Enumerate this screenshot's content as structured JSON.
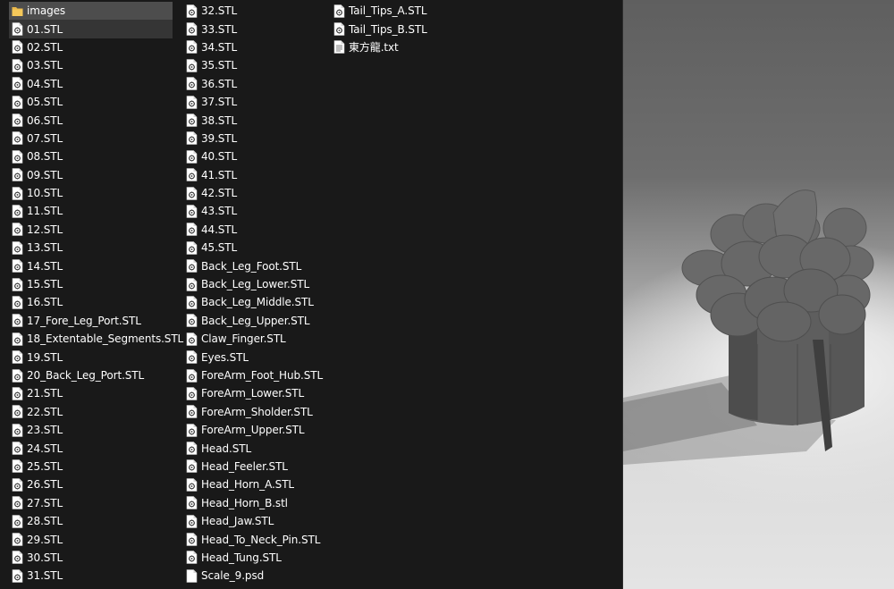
{
  "files": {
    "columns": [
      [
        {
          "name": "images",
          "type": "folder",
          "state": "selected"
        },
        {
          "name": "01.STL",
          "type": "stl",
          "state": "focused"
        },
        {
          "name": "02.STL",
          "type": "stl"
        },
        {
          "name": "03.STL",
          "type": "stl"
        },
        {
          "name": "04.STL",
          "type": "stl"
        },
        {
          "name": "05.STL",
          "type": "stl"
        },
        {
          "name": "06.STL",
          "type": "stl"
        },
        {
          "name": "07.STL",
          "type": "stl"
        },
        {
          "name": "08.STL",
          "type": "stl"
        },
        {
          "name": "09.STL",
          "type": "stl"
        },
        {
          "name": "10.STL",
          "type": "stl"
        },
        {
          "name": "11.STL",
          "type": "stl"
        },
        {
          "name": "12.STL",
          "type": "stl"
        },
        {
          "name": "13.STL",
          "type": "stl"
        },
        {
          "name": "14.STL",
          "type": "stl"
        },
        {
          "name": "15.STL",
          "type": "stl"
        },
        {
          "name": "16.STL",
          "type": "stl"
        },
        {
          "name": "17_Fore_Leg_Port.STL",
          "type": "stl"
        },
        {
          "name": "18_Extentable_Segments.STL",
          "type": "stl"
        },
        {
          "name": "19.STL",
          "type": "stl"
        },
        {
          "name": "20_Back_Leg_Port.STL",
          "type": "stl"
        },
        {
          "name": "21.STL",
          "type": "stl"
        },
        {
          "name": "22.STL",
          "type": "stl"
        },
        {
          "name": "23.STL",
          "type": "stl"
        },
        {
          "name": "24.STL",
          "type": "stl"
        },
        {
          "name": "25.STL",
          "type": "stl"
        },
        {
          "name": "26.STL",
          "type": "stl"
        },
        {
          "name": "27.STL",
          "type": "stl"
        },
        {
          "name": "28.STL",
          "type": "stl"
        },
        {
          "name": "29.STL",
          "type": "stl"
        },
        {
          "name": "30.STL",
          "type": "stl"
        },
        {
          "name": "31.STL",
          "type": "stl"
        }
      ],
      [
        {
          "name": "32.STL",
          "type": "stl"
        },
        {
          "name": "33.STL",
          "type": "stl"
        },
        {
          "name": "34.STL",
          "type": "stl"
        },
        {
          "name": "35.STL",
          "type": "stl"
        },
        {
          "name": "36.STL",
          "type": "stl"
        },
        {
          "name": "37.STL",
          "type": "stl"
        },
        {
          "name": "38.STL",
          "type": "stl"
        },
        {
          "name": "39.STL",
          "type": "stl"
        },
        {
          "name": "40.STL",
          "type": "stl"
        },
        {
          "name": "41.STL",
          "type": "stl"
        },
        {
          "name": "42.STL",
          "type": "stl"
        },
        {
          "name": "43.STL",
          "type": "stl"
        },
        {
          "name": "44.STL",
          "type": "stl"
        },
        {
          "name": "45.STL",
          "type": "stl"
        },
        {
          "name": "Back_Leg_Foot.STL",
          "type": "stl"
        },
        {
          "name": "Back_Leg_Lower.STL",
          "type": "stl"
        },
        {
          "name": "Back_Leg_Middle.STL",
          "type": "stl"
        },
        {
          "name": "Back_Leg_Upper.STL",
          "type": "stl"
        },
        {
          "name": "Claw_Finger.STL",
          "type": "stl"
        },
        {
          "name": "Eyes.STL",
          "type": "stl"
        },
        {
          "name": "ForeArm_Foot_Hub.STL",
          "type": "stl"
        },
        {
          "name": "ForeArm_Lower.STL",
          "type": "stl"
        },
        {
          "name": "ForeArm_Sholder.STL",
          "type": "stl"
        },
        {
          "name": "ForeArm_Upper.STL",
          "type": "stl"
        },
        {
          "name": "Head.STL",
          "type": "stl"
        },
        {
          "name": "Head_Feeler.STL",
          "type": "stl"
        },
        {
          "name": "Head_Horn_A.STL",
          "type": "stl"
        },
        {
          "name": "Head_Horn_B.stl",
          "type": "stl"
        },
        {
          "name": "Head_Jaw.STL",
          "type": "stl"
        },
        {
          "name": "Head_To_Neck_Pin.STL",
          "type": "stl"
        },
        {
          "name": "Head_Tung.STL",
          "type": "stl"
        },
        {
          "name": "Scale_9.psd",
          "type": "psd"
        }
      ],
      [
        {
          "name": "Tail_Tips_A.STL",
          "type": "stl"
        },
        {
          "name": "Tail_Tips_B.STL",
          "type": "stl"
        },
        {
          "name": "東方龍.txt",
          "type": "txt"
        }
      ]
    ]
  },
  "icons": {
    "folder": "folder-icon",
    "stl": "stl-file-icon",
    "psd": "blank-file-icon",
    "txt": "text-file-icon"
  },
  "colors": {
    "background": "#191919",
    "selection": "#4d4d4d",
    "focus": "#353535",
    "folder": "#e8b64a"
  }
}
